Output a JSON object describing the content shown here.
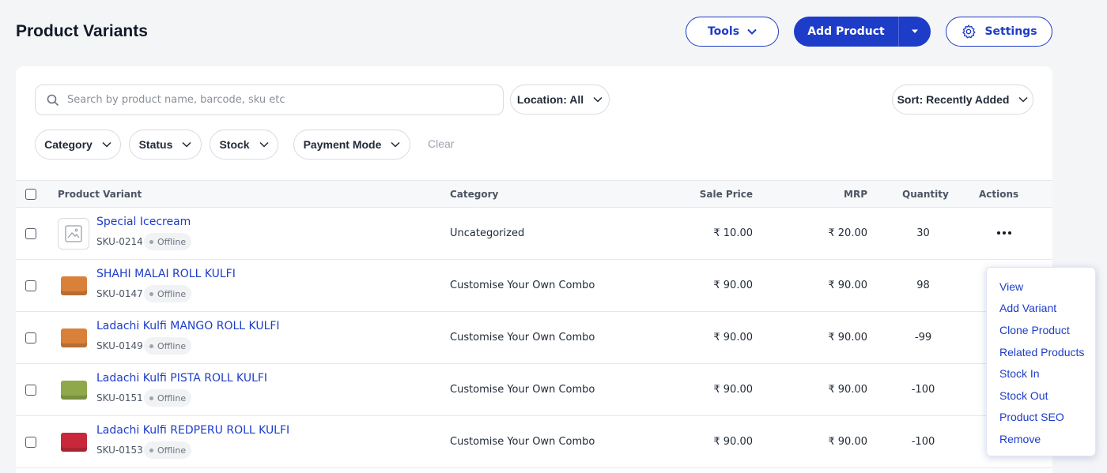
{
  "page": {
    "title": "Product Variants"
  },
  "toolbar": {
    "tools_label": "Tools",
    "add_product_label": "Add Product",
    "settings_label": "Settings"
  },
  "search": {
    "placeholder": "Search by product name, barcode, sku etc"
  },
  "filters": {
    "location_label": "Location: All",
    "sort_label": "Sort: Recently Added",
    "category_label": "Category",
    "status_label": "Status",
    "stock_label": "Stock",
    "payment_mode_label": "Payment Mode",
    "clear_label": "Clear"
  },
  "table": {
    "headers": {
      "variant": "Product Variant",
      "category": "Category",
      "sale_price": "Sale Price",
      "mrp": "MRP",
      "quantity": "Quantity",
      "actions": "Actions"
    },
    "rows": [
      {
        "name": "Special Icecream",
        "sku": "SKU-0214",
        "status": "Offline",
        "category": "Uncategorized",
        "sale_price": "₹ 10.00",
        "mrp": "₹ 20.00",
        "quantity": "30",
        "thumb": "placeholder-image-icon"
      },
      {
        "name": "SHAHI MALAI ROLL KULFI",
        "sku": "SKU-0147",
        "status": "Offline",
        "category": "Customise Your Own Combo",
        "sale_price": "₹ 90.00",
        "mrp": "₹ 90.00",
        "quantity": "98",
        "thumb": "orange-box"
      },
      {
        "name": "Ladachi Kulfi MANGO ROLL KULFI",
        "sku": "SKU-0149",
        "status": "Offline",
        "category": "Customise Your Own Combo",
        "sale_price": "₹ 90.00",
        "mrp": "₹ 90.00",
        "quantity": "-99",
        "thumb": "orange-box"
      },
      {
        "name": "Ladachi Kulfi PISTA ROLL KULFI",
        "sku": "SKU-0151",
        "status": "Offline",
        "category": "Customise Your Own Combo",
        "sale_price": "₹ 90.00",
        "mrp": "₹ 90.00",
        "quantity": "-100",
        "thumb": "green-box"
      },
      {
        "name": "Ladachi Kulfi REDPERU ROLL KULFI",
        "sku": "SKU-0153",
        "status": "Offline",
        "category": "Customise Your Own Combo",
        "sale_price": "₹ 90.00",
        "mrp": "₹ 90.00",
        "quantity": "-100",
        "thumb": "red-box"
      }
    ]
  },
  "actions_menu": {
    "items": [
      "View",
      "Add Variant",
      "Clone Product",
      "Related Products",
      "Stock In",
      "Stock Out",
      "Product SEO",
      "Remove"
    ]
  },
  "colors": {
    "primary": "#1d3cc8",
    "thumb_orange": "#d9803a",
    "thumb_green": "#8fa84a",
    "thumb_red": "#c8283a"
  }
}
